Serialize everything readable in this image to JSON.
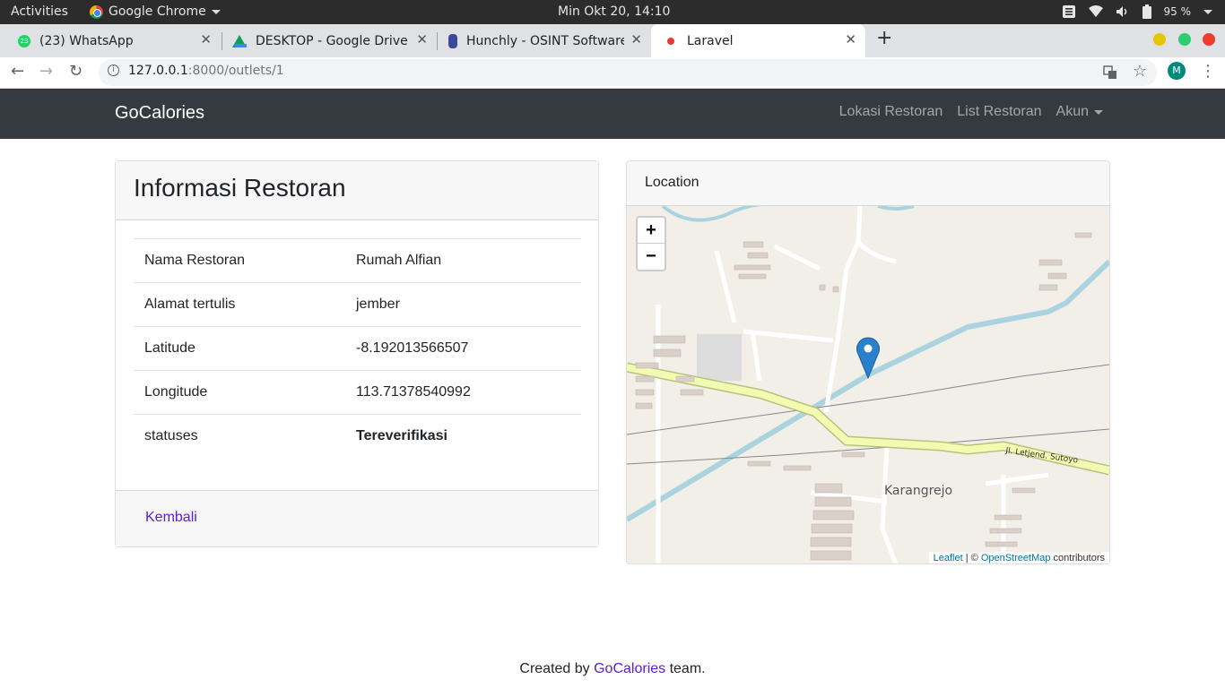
{
  "os": {
    "activities": "Activities",
    "app_name": "Google Chrome",
    "clock": "Min Okt 20, 14:10",
    "battery": "95 %"
  },
  "tabs": [
    {
      "title": "(23) WhatsApp",
      "badge": "23"
    },
    {
      "title": "DESKTOP - Google Drive"
    },
    {
      "title": "Hunchly - OSINT Software"
    },
    {
      "title": "Laravel"
    }
  ],
  "toolbar": {
    "url_host": "127.0.0.1",
    "url_rest": ":8000/outlets/1",
    "profile_initial": "M"
  },
  "navbar": {
    "brand": "GoCalories",
    "links": [
      "Lokasi Restoran",
      "List Restoran"
    ],
    "account": "Akun"
  },
  "info": {
    "title": "Informasi Restoran",
    "rows": [
      {
        "label": "Nama Restoran",
        "value": "Rumah Alfian"
      },
      {
        "label": "Alamat tertulis",
        "value": "jember"
      },
      {
        "label": "Latitude",
        "value": "-8.192013566507"
      },
      {
        "label": "Longitude",
        "value": "113.71378540992"
      },
      {
        "label": "statuses",
        "value": "Tereverifikasi"
      }
    ],
    "back": "Kembali"
  },
  "map": {
    "title": "Location",
    "zoom_in": "+",
    "zoom_out": "−",
    "place": "Karangrejo",
    "road": "Jl. Letjend. Sutoyo",
    "attr_leaflet": "Leaflet",
    "attr_sep": " | © ",
    "attr_osm": "OpenStreetMap",
    "attr_tail": " contributors"
  },
  "footer": {
    "pre": "Created by ",
    "link": "GoCalories",
    "post": " team."
  },
  "colors": {
    "navbar": "#343a40",
    "link": "#5b19d8",
    "river": "#aad3df",
    "main_road": "#f1fbb2",
    "marker": "#2a81cb"
  }
}
